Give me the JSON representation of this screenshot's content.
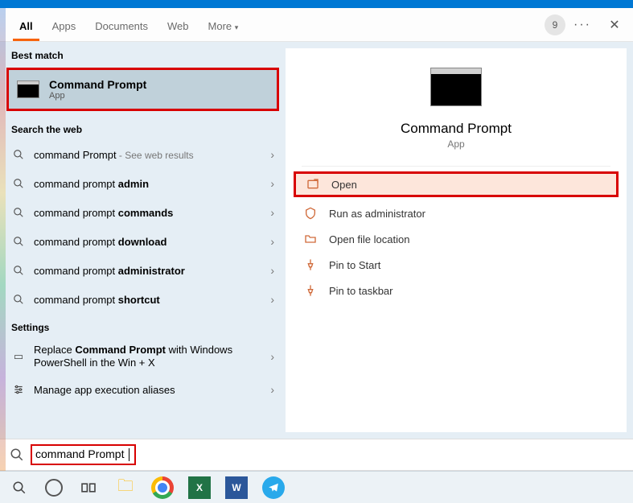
{
  "header": {
    "tabs": [
      "All",
      "Apps",
      "Documents",
      "Web",
      "More"
    ],
    "active_tab": 0,
    "counter": "9"
  },
  "left": {
    "best_match_label": "Best match",
    "best_match": {
      "title": "Command Prompt",
      "subtitle": "App"
    },
    "web_label": "Search the web",
    "web_results": [
      {
        "prefix": "command Prompt",
        "bold": "",
        "hint": " - See web results"
      },
      {
        "prefix": "command prompt ",
        "bold": "admin",
        "hint": ""
      },
      {
        "prefix": "command prompt ",
        "bold": "commands",
        "hint": ""
      },
      {
        "prefix": "command prompt ",
        "bold": "download",
        "hint": ""
      },
      {
        "prefix": "command prompt ",
        "bold": "administrator",
        "hint": ""
      },
      {
        "prefix": "command prompt ",
        "bold": "shortcut",
        "hint": ""
      }
    ],
    "settings_label": "Settings",
    "settings": [
      {
        "text_a": "Replace ",
        "text_b": "Command Prompt",
        "text_c": " with Windows PowerShell in the Win + X"
      },
      {
        "text_a": "Manage app execution aliases",
        "text_b": "",
        "text_c": ""
      }
    ]
  },
  "right": {
    "title": "Command Prompt",
    "subtitle": "App",
    "actions": [
      {
        "icon": "open-icon",
        "label": "Open",
        "hi": true
      },
      {
        "icon": "shield-icon",
        "label": "Run as administrator",
        "hi": false
      },
      {
        "icon": "folder-icon",
        "label": "Open file location",
        "hi": false
      },
      {
        "icon": "pin-icon",
        "label": "Pin to Start",
        "hi": false
      },
      {
        "icon": "pin-icon",
        "label": "Pin to taskbar",
        "hi": false
      }
    ]
  },
  "search": {
    "value": "command Prompt"
  },
  "taskbar": {
    "excel": "X",
    "word": "W"
  }
}
